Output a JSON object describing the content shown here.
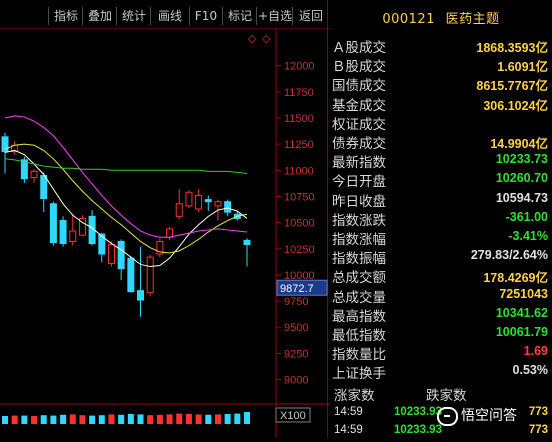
{
  "toolbar": {
    "buttons": [
      "指标",
      "叠加",
      "统计",
      "画线",
      "F10",
      "标记",
      "+自选",
      "返回"
    ]
  },
  "stock": {
    "code": "000121",
    "name": "医药主题"
  },
  "chart_data": {
    "type": "candlestick",
    "price_axis": {
      "ticks": [
        12000,
        11750,
        11500,
        11250,
        11000,
        10750,
        10500,
        10250,
        10000,
        9750,
        9500,
        9250,
        9000
      ],
      "range": [
        8900,
        12150
      ]
    },
    "current_label": "9872.7",
    "volume_scale_label": "X100",
    "candles": [
      {
        "o": 11320,
        "c": 11180,
        "h": 11360,
        "l": 10970
      },
      {
        "o": 11180,
        "c": 11240,
        "h": 11280,
        "l": 11150
      },
      {
        "o": 11100,
        "c": 10920,
        "h": 11130,
        "l": 10880
      },
      {
        "o": 10930,
        "c": 10990,
        "h": 11010,
        "l": 10880
      },
      {
        "o": 10950,
        "c": 10730,
        "h": 10980,
        "l": 10600
      },
      {
        "o": 10680,
        "c": 10310,
        "h": 10700,
        "l": 10280
      },
      {
        "o": 10520,
        "c": 10300,
        "h": 10560,
        "l": 10270
      },
      {
        "o": 10320,
        "c": 10420,
        "h": 10580,
        "l": 10280
      },
      {
        "o": 10380,
        "c": 10540,
        "h": 10570,
        "l": 10370
      },
      {
        "o": 10560,
        "c": 10300,
        "h": 10620,
        "l": 10280
      },
      {
        "o": 10390,
        "c": 10200,
        "h": 10400,
        "l": 10120
      },
      {
        "o": 10110,
        "c": 10290,
        "h": 10320,
        "l": 10080
      },
      {
        "o": 10320,
        "c": 10060,
        "h": 10340,
        "l": 9950
      },
      {
        "o": 10160,
        "c": 9840,
        "h": 10180,
        "l": 9830
      },
      {
        "o": 9850,
        "c": 9760,
        "h": 10270,
        "l": 9600
      },
      {
        "o": 9830,
        "c": 10170,
        "h": 10190,
        "l": 9800
      },
      {
        "o": 10200,
        "c": 10320,
        "h": 10350,
        "l": 10170
      },
      {
        "o": 10360,
        "c": 10440,
        "h": 10460,
        "l": 10330
      },
      {
        "o": 10560,
        "c": 10680,
        "h": 10820,
        "l": 10530
      },
      {
        "o": 10660,
        "c": 10790,
        "h": 10810,
        "l": 10640
      },
      {
        "o": 10630,
        "c": 10760,
        "h": 10820,
        "l": 10600
      },
      {
        "o": 10720,
        "c": 10700,
        "h": 10760,
        "l": 10610
      },
      {
        "o": 10660,
        "c": 10700,
        "h": 10720,
        "l": 10520
      },
      {
        "o": 10700,
        "c": 10600,
        "h": 10720,
        "l": 10560
      },
      {
        "o": 10580,
        "c": 10540,
        "h": 10610,
        "l": 10520
      },
      {
        "o": 10330,
        "c": 10290,
        "h": 10350,
        "l": 10080
      }
    ],
    "ma_lines": [
      {
        "color": "#ffffff",
        "values": [
          11170,
          11190,
          11150,
          11060,
          10960,
          10820,
          10680,
          10570,
          10500,
          10450,
          10370,
          10300,
          10240,
          10170,
          10100,
          10080,
          10090,
          10160,
          10270,
          10390,
          10480,
          10560,
          10620,
          10640,
          10610,
          10540
        ]
      },
      {
        "color": "#e8e840",
        "values": [
          11200,
          11240,
          11250,
          11240,
          11190,
          11110,
          11010,
          10900,
          10800,
          10710,
          10630,
          10550,
          10480,
          10400,
          10320,
          10260,
          10220,
          10210,
          10230,
          10280,
          10340,
          10410,
          10470,
          10520,
          10560,
          10580
        ]
      },
      {
        "color": "#ff40ff",
        "values": [
          11500,
          11520,
          11510,
          11470,
          11410,
          11330,
          11220,
          11100,
          10980,
          10870,
          10760,
          10660,
          10570,
          10490,
          10420,
          10380,
          10360,
          10360,
          10380,
          10400,
          10420,
          10430,
          10440,
          10430,
          10420,
          10410
        ]
      },
      {
        "color": "#30d030",
        "values": [
          11110,
          11100,
          11080,
          11060,
          11040,
          11030,
          11020,
          11020,
          11010,
          11010,
          11010,
          11000,
          11000,
          11000,
          11000,
          11000,
          11000,
          11000,
          11000,
          11000,
          11000,
          10990,
          10990,
          10990,
          10980,
          10970
        ]
      }
    ],
    "volume": [
      0.5,
      0.55,
      0.55,
      0.5,
      0.6,
      0.55,
      0.65,
      0.7,
      0.6,
      0.55,
      0.6,
      0.7,
      0.65,
      0.75,
      0.7,
      0.6,
      0.65,
      0.7,
      0.8,
      0.75,
      0.7,
      0.65,
      0.7,
      0.75,
      0.8,
      1.0
    ]
  },
  "info": {
    "rows": [
      {
        "label": "Ａ股成交",
        "value": "1868.3593亿",
        "color": "#ffd24a"
      },
      {
        "label": "Ｂ股成交",
        "value": "1.6091亿",
        "color": "#ffd24a"
      },
      {
        "label": "国债成交",
        "value": "8615.7767亿",
        "color": "#ffd24a"
      },
      {
        "label": "基金成交",
        "value": "306.1024亿",
        "color": "#ffd24a"
      },
      {
        "label": "权证成交",
        "value": "",
        "color": "#ffd24a"
      },
      {
        "label": "债券成交",
        "value": "14.9904亿",
        "color": "#ffd24a"
      },
      {
        "label": "最新指数",
        "value": "10233.73",
        "color": "#30e030"
      },
      {
        "label": "今日开盘",
        "value": "10260.70",
        "color": "#30e030"
      },
      {
        "label": "昨日收盘",
        "value": "10594.73",
        "color": "#e0e0e0"
      },
      {
        "label": "指数涨跌",
        "value": "-361.00",
        "color": "#30e030"
      },
      {
        "label": "指数涨幅",
        "value": "-3.41%",
        "color": "#30e030"
      },
      {
        "label": "指数振幅",
        "value": "279.83/2.64%",
        "color": "#e0e0e0"
      },
      {
        "label": "总成交额",
        "value": "178.4269亿",
        "color": "#ffd24a"
      },
      {
        "label": "总成交量",
        "value": "7251043",
        "color": "#ffd24a"
      },
      {
        "label": "最高指数",
        "value": "10341.62",
        "color": "#30e030"
      },
      {
        "label": "最低指数",
        "value": "10061.79",
        "color": "#30e030"
      },
      {
        "label": "指数量比",
        "value": "1.69",
        "color": "#ff4040"
      },
      {
        "label": "上证换手",
        "value": "0.53%",
        "color": "#e0e0e0"
      }
    ],
    "rise_count_label": "涨家数",
    "fall_count_label": "跌家数"
  },
  "ticks": [
    {
      "time": "14:59",
      "price": "10233.93",
      "count": "773"
    },
    {
      "time": "14:59",
      "price": "10233.93",
      "count": "773"
    }
  ],
  "watermark": "悟空问答"
}
